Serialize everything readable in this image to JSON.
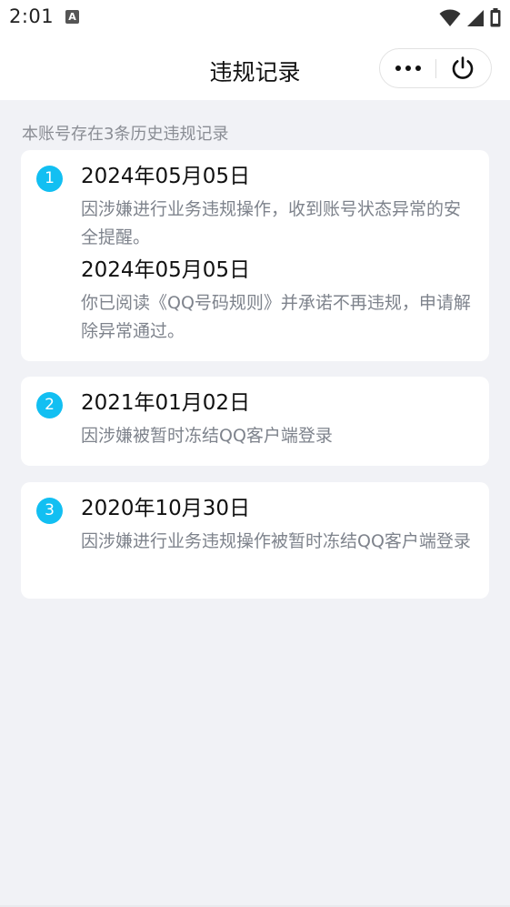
{
  "status_bar": {
    "time": "2:01",
    "app_icon_letter": "A",
    "icons": [
      "wifi-icon",
      "signal-icon",
      "battery-icon"
    ]
  },
  "nav": {
    "title": "违规记录",
    "more_icon": "more-icon",
    "power_icon": "power-icon"
  },
  "summary": "本账号存在3条历史违规记录",
  "records": [
    {
      "number": "1",
      "entries": [
        {
          "date": "2024年05月05日",
          "description": "因涉嫌进行业务违规操作，收到账号状态异常的安全提醒。"
        },
        {
          "date": "2024年05月05日",
          "description": "你已阅读《QQ号码规则》并承诺不再违规，申请解除异常通过。"
        }
      ]
    },
    {
      "number": "2",
      "entries": [
        {
          "date": "2021年01月02日",
          "description": "因涉嫌被暂时冻结QQ客户端登录"
        }
      ]
    },
    {
      "number": "3",
      "entries": [
        {
          "date": "2020年10月30日",
          "description": "因涉嫌进行业务违规操作被暂时冻结QQ客户端登录"
        }
      ]
    }
  ],
  "colors": {
    "accent": "#12bff2",
    "background": "#f1f2f6",
    "muted_text": "#7e838c"
  }
}
